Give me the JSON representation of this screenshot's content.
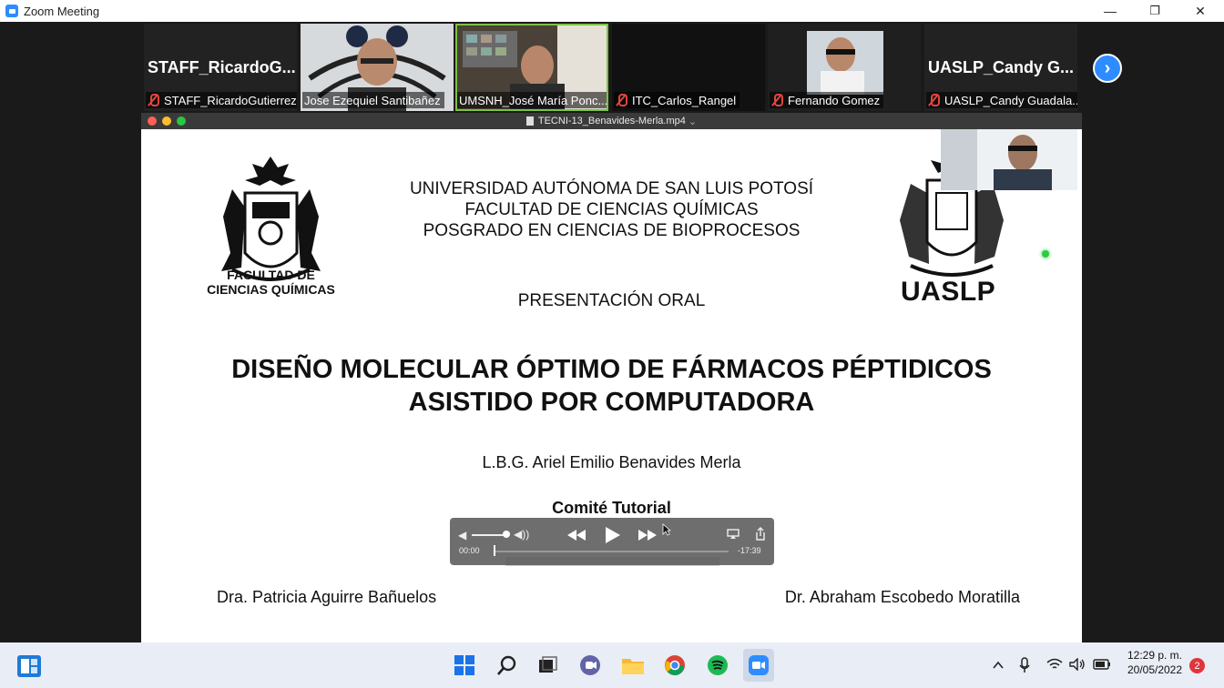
{
  "window": {
    "title": "Zoom Meeting",
    "minimize_glyph": "—",
    "maximize_glyph": "❐",
    "close_glyph": "✕"
  },
  "participants": [
    {
      "big_name": "STAFF_RicardoG...",
      "label": "STAFF_RicardoGutierrez",
      "muted": true,
      "video": false
    },
    {
      "big_name": "",
      "label": "Jose Ezequiel Santibañez",
      "muted": false,
      "video": true
    },
    {
      "big_name": "",
      "label": "UMSNH_José María Ponc...",
      "muted": false,
      "video": true,
      "active_speaker": true
    },
    {
      "big_name": "",
      "label": "ITC_Carlos_Rangel",
      "muted": true,
      "video": false
    },
    {
      "big_name": "",
      "label": "Fernando Gomez",
      "muted": true,
      "video": true
    },
    {
      "big_name": "UASLP_Candy  G...",
      "label": "UASLP_Candy Guadala...",
      "muted": true,
      "video": false
    }
  ],
  "next_page_glyph": "›",
  "share": {
    "file_name": "TECNI-13_Benavides-Merla.mp4",
    "dropdown_glyph": "⌄",
    "traffic_colors": [
      "#ff5f57",
      "#febc2e",
      "#28c840"
    ]
  },
  "slide": {
    "institution_lines": [
      "UNIVERSIDAD AUTÓNOMA DE SAN LUIS POTOSÍ",
      "FACULTAD DE CIENCIAS QUÍMICAS",
      "POSGRADO EN CIENCIAS DE BIOPROCESOS"
    ],
    "fcq_logo_line1": "FACULTAD DE",
    "fcq_logo_line2": "CIENCIAS QUÍMICAS",
    "uaslp_logo_text": "UASLP",
    "presentation_type": "PRESENTACIÓN ORAL",
    "title_line1": "DISEÑO MOLECULAR ÓPTIMO DE FÁRMACOS PÉPTIDICOS",
    "title_line2": "ASISTIDO POR COMPUTADORA",
    "author": "L.B.G. Ariel Emilio Benavides Merla",
    "committee_heading": "Comité Tutorial",
    "advisor_left": "Dra. Patricia Aguirre Bañuelos",
    "advisor_right": "Dr. Abraham Escobedo Moratilla"
  },
  "player": {
    "elapsed": "00:00",
    "remaining": "-17:39",
    "progress_fraction": 0,
    "volume_fraction": 0.85
  },
  "taskbar": {
    "time": "12:29 p. m.",
    "date": "20/05/2022",
    "notification_count": "2"
  },
  "colors": {
    "zoom_blue": "#2d8cff",
    "active_speaker_border": "#7cc242",
    "muted_red": "#e2453c"
  }
}
